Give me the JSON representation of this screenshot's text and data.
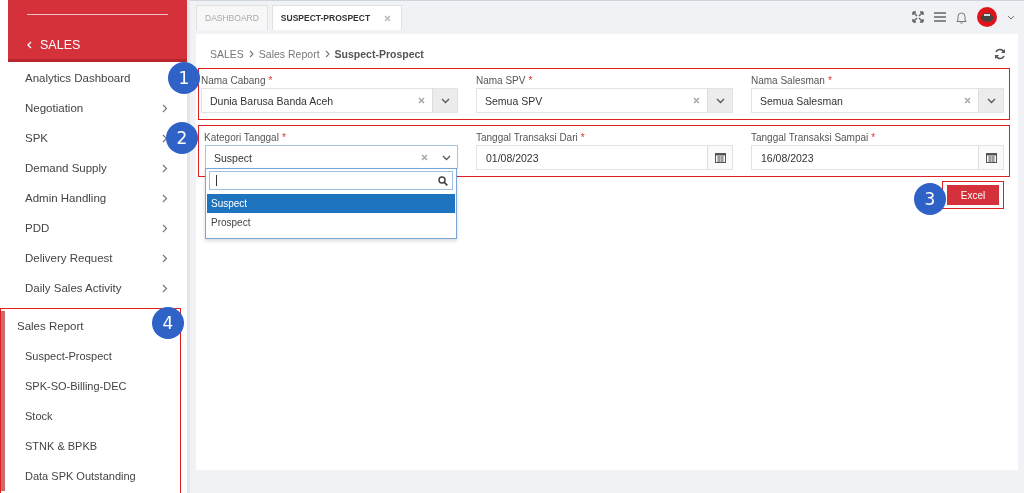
{
  "sidebar": {
    "header": "SALES",
    "items": [
      {
        "label": "Analytics Dashboard",
        "kind": "link"
      },
      {
        "label": "Negotiation",
        "kind": "menu",
        "expanded": false
      },
      {
        "label": "SPK",
        "kind": "menu",
        "expanded": false
      },
      {
        "label": "Demand Supply",
        "kind": "menu",
        "expanded": false
      },
      {
        "label": "Admin Handling",
        "kind": "menu",
        "expanded": false
      },
      {
        "label": "PDD",
        "kind": "menu",
        "expanded": false
      },
      {
        "label": "Delivery Request",
        "kind": "menu",
        "expanded": false
      },
      {
        "label": "Daily Sales Activity",
        "kind": "menu",
        "expanded": false
      },
      {
        "label": "Sales Report",
        "kind": "menu",
        "expanded": true,
        "callout": "4",
        "children": [
          {
            "label": "Suspect-Prospect"
          },
          {
            "label": "SPK-SO-Billing-DEC"
          },
          {
            "label": "Stock"
          },
          {
            "label": "STNK & BPKB"
          },
          {
            "label": "Data SPK Outstanding"
          }
        ]
      }
    ]
  },
  "tabs": [
    {
      "label": "DASHBOARD",
      "selected": false,
      "closable": false
    },
    {
      "label": "SUSPECT-PROSPECT",
      "selected": true,
      "closable": true
    }
  ],
  "breadcrumb": [
    "SALES",
    "Sales Report",
    "Suspect-Prospect"
  ],
  "form": {
    "rows": [
      {
        "callout": "1",
        "fields": [
          {
            "label": "Nama Cabang",
            "required_mark": "*",
            "kind": "select",
            "value": "Dunia Barusa Banda Aceh",
            "open": false
          },
          {
            "label": "Nama SPV",
            "required_mark": "*",
            "kind": "select",
            "value": "Semua SPV",
            "open": false
          },
          {
            "label": "Nama Salesman",
            "required_mark": "*",
            "kind": "select",
            "value": "Semua Salesman",
            "open": false
          }
        ]
      },
      {
        "callout": "2",
        "fields": [
          {
            "label": "Kategori Tanggal",
            "required_mark": "*",
            "kind": "select",
            "value": "Suspect",
            "open": true,
            "options": [
              {
                "label": "Suspect",
                "selected": true
              },
              {
                "label": "Prospect",
                "selected": false
              }
            ]
          },
          {
            "label": "Tanggal Transaksi Dari",
            "required_mark": "*",
            "kind": "date",
            "value": "01/08/2023"
          },
          {
            "label": "Tanggal Transaksi Sampai",
            "required_mark": "*",
            "kind": "date",
            "value": "16/08/2023"
          }
        ]
      }
    ]
  },
  "export_button": {
    "label": "Excel",
    "callout": "3"
  }
}
